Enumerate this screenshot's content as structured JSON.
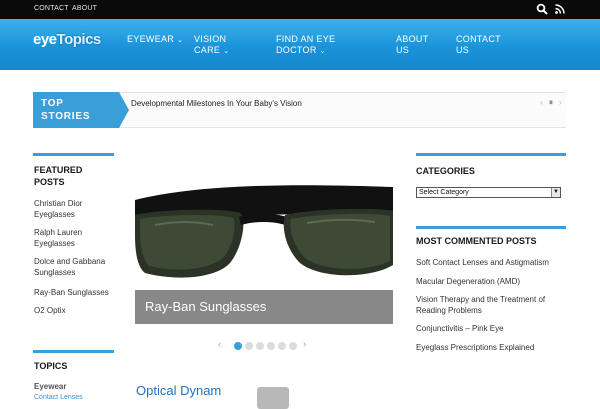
{
  "topbar": {
    "contact": "CONTACT",
    "about": "ABOUT"
  },
  "logo": {
    "part1": "eye",
    "part2": "Topics"
  },
  "nav": {
    "eyewear": "EYEWEAR",
    "vision_line1": "VISION",
    "vision_line2": "CARE",
    "find_line1": "FIND AN EYE",
    "find_line2": "DOCTOR",
    "about_line1": "ABOUT",
    "about_line2": "US",
    "contact_line1": "CONTACT",
    "contact_line2": "US"
  },
  "top_stories": {
    "label_line1": "TOP",
    "label_line2": "STORIES",
    "item": "Developmental Milestones In Your Baby's Vision"
  },
  "featured_posts": {
    "heading_line1": "FEATURED",
    "heading_line2": "POSTS",
    "items": [
      {
        "line1": "Christian Dior",
        "line2": "Eyeglasses"
      },
      {
        "line1": "Ralph Lauren",
        "line2": "Eyeglasses"
      },
      {
        "line1": "Dolce and Gabbana",
        "line2": "Sunglasses"
      },
      {
        "line1": "Ray-Ban Sunglasses",
        "line2": ""
      },
      {
        "line1": "O2 Optix",
        "line2": ""
      }
    ]
  },
  "topics": {
    "heading": "TOPICS",
    "sub": "Eyewear",
    "sub2": "Contact Lenses"
  },
  "slider": {
    "caption": "Ray-Ban Sunglasses",
    "dot_count": 6,
    "active_dot": 1
  },
  "categories": {
    "heading": "CATEGORIES",
    "select_value": "Select Category"
  },
  "most_commented": {
    "heading": "MOST COMMENTED POSTS",
    "items": [
      {
        "line1": "Soft Contact Lenses and Astigmatism",
        "line2": ""
      },
      {
        "line1": "Macular Degeneration (AMD)",
        "line2": ""
      },
      {
        "line1": "Vision Therapy and the Treatment of",
        "line2": "Reading Problems"
      },
      {
        "line1": "Conjunctivitis – Pink Eye",
        "line2": ""
      },
      {
        "line1": "Eyeglass Prescriptions Explained",
        "line2": ""
      }
    ]
  },
  "featured_article": {
    "title": "Optical Dynam"
  },
  "colors": {
    "accent": "#3a9fd8",
    "header_blue": "#1a93d9",
    "topbar": "#0a0a0a",
    "link_blue": "#1a73c9"
  },
  "icons": {
    "search": "search-icon",
    "rss": "rss-icon",
    "prev": "chevron-left-icon",
    "pause": "pause-icon",
    "next": "chevron-right-icon"
  }
}
